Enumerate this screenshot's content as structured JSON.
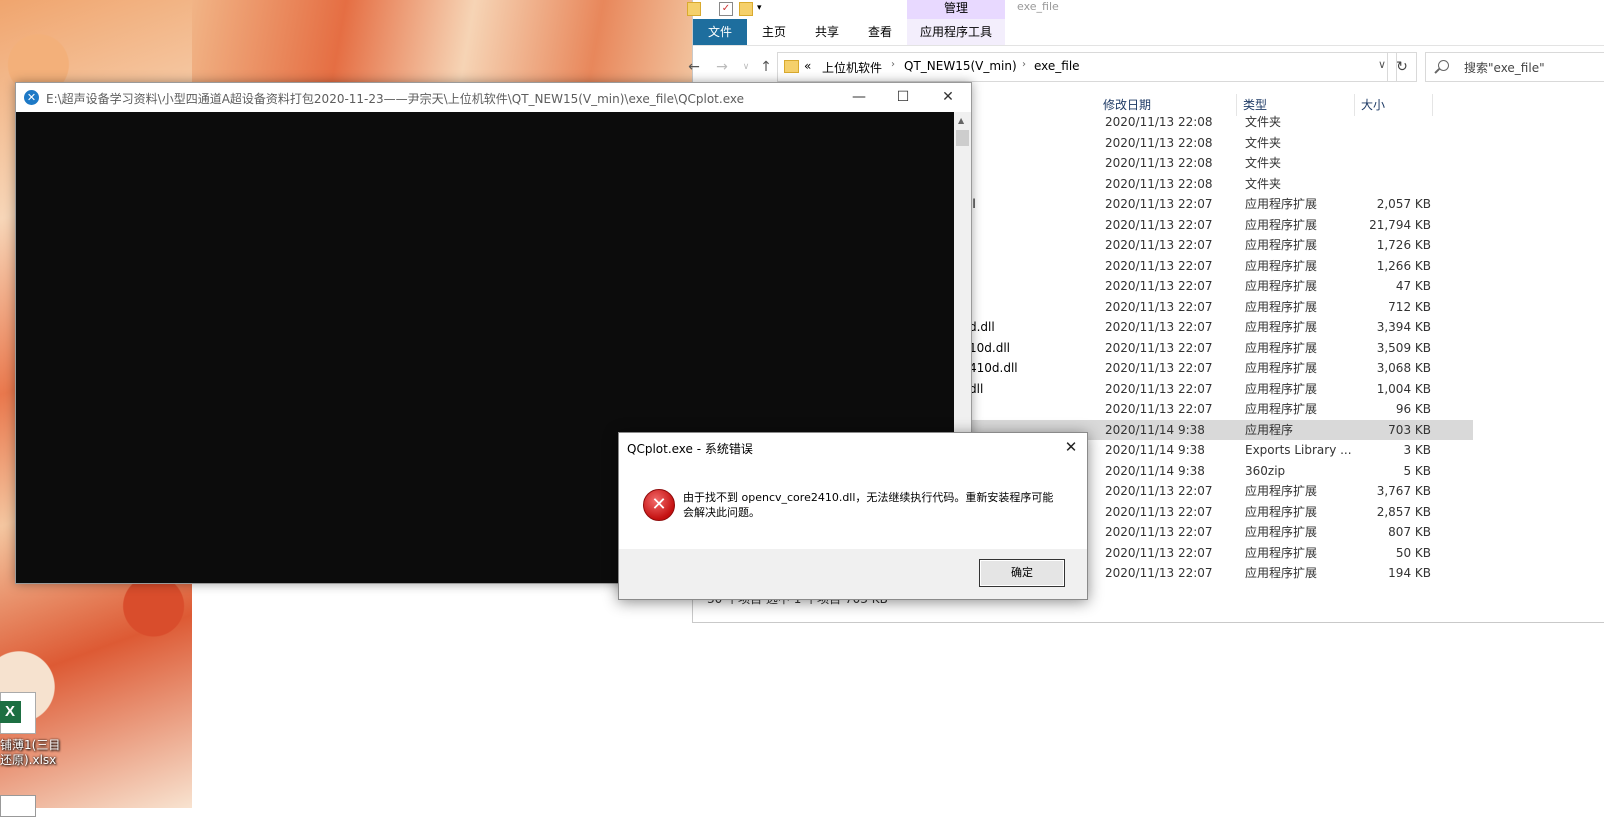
{
  "desktop": {
    "icon_label_1": "铺薄1(三目",
    "icon_label_2": "还原).xlsx"
  },
  "explorer": {
    "tab_manage": "管理",
    "title_mini": "exe_file",
    "ribbon_tabs": {
      "file": "文件",
      "home": "主页",
      "share": "共享",
      "view": "查看",
      "app_tools": "应用程序工具"
    },
    "breadcrumb": {
      "prefix": "«",
      "items": [
        "上位机软件",
        "QT_NEW15(V_min)",
        "exe_file"
      ]
    },
    "search_placeholder": "搜索\"exe_file\"",
    "columns": {
      "date": "修改日期",
      "type": "类型",
      "size": "大小"
    },
    "rows": [
      {
        "name": "",
        "date": "2020/11/13 22:08",
        "type": "文件夹",
        "size": ""
      },
      {
        "name": "",
        "date": "2020/11/13 22:08",
        "type": "文件夹",
        "size": ""
      },
      {
        "name": "",
        "date": "2020/11/13 22:08",
        "type": "文件夹",
        "size": ""
      },
      {
        "name": "",
        "date": "2020/11/13 22:08",
        "type": "文件夹",
        "size": ""
      },
      {
        "name": "ll",
        "date": "2020/11/13 22:07",
        "type": "应用程序扩展",
        "size": "2,057 KB"
      },
      {
        "name": "",
        "date": "2020/11/13 22:07",
        "type": "应用程序扩展",
        "size": "21,794 KB"
      },
      {
        "name": "",
        "date": "2020/11/13 22:07",
        "type": "应用程序扩展",
        "size": "1,726 KB"
      },
      {
        "name": "",
        "date": "2020/11/13 22:07",
        "type": "应用程序扩展",
        "size": "1,266 KB"
      },
      {
        "name": "",
        "date": "2020/11/13 22:07",
        "type": "应用程序扩展",
        "size": "47 KB"
      },
      {
        "name": "",
        "date": "2020/11/13 22:07",
        "type": "应用程序扩展",
        "size": "712 KB"
      },
      {
        "name": "d.dll",
        "date": "2020/11/13 22:07",
        "type": "应用程序扩展",
        "size": "3,394 KB"
      },
      {
        "name": "10d.dll",
        "date": "2020/11/13 22:07",
        "type": "应用程序扩展",
        "size": "3,509 KB"
      },
      {
        "name": "410d.dll",
        "date": "2020/11/13 22:07",
        "type": "应用程序扩展",
        "size": "3,068 KB"
      },
      {
        "name": "dll",
        "date": "2020/11/13 22:07",
        "type": "应用程序扩展",
        "size": "1,004 KB"
      },
      {
        "name": "",
        "date": "2020/11/13 22:07",
        "type": "应用程序扩展",
        "size": "96 KB"
      },
      {
        "name": "",
        "date": "2020/11/14 9:38",
        "type": "应用程序",
        "size": "703 KB"
      },
      {
        "name": "",
        "date": "2020/11/14 9:38",
        "type": "Exports Library ...",
        "size": "3 KB"
      },
      {
        "name": "",
        "date": "2020/11/14 9:38",
        "type": "360zip",
        "size": "5 KB"
      },
      {
        "name": "",
        "date": "2020/11/13 22:07",
        "type": "应用程序扩展",
        "size": "3,767 KB"
      },
      {
        "name": "",
        "date": "2020/11/13 22:07",
        "type": "应用程序扩展",
        "size": "2,857 KB"
      },
      {
        "name": "",
        "date": "2020/11/13 22:07",
        "type": "应用程序扩展",
        "size": "807 KB"
      },
      {
        "name": "",
        "date": "2020/11/13 22:07",
        "type": "应用程序扩展",
        "size": "50 KB"
      },
      {
        "name": "",
        "date": "2020/11/13 22:07",
        "type": "应用程序扩展",
        "size": "194 KB"
      }
    ],
    "selected_row_index": 15,
    "status_text": "30 个项目    选中 1 个项目  703 KB"
  },
  "console": {
    "title": "E:\\超声设备学习资料\\小型四通道A超设备资料打包2020-11-23——尹宗天\\上位机软件\\QT_NEW15(V_min)\\exe_file\\QCplot.exe",
    "body_bg": "#0c0c0c"
  },
  "dialog": {
    "title": "QCplot.exe - 系统错误",
    "message": "由于找不到 opencv_core2410.dll，无法继续执行代码。重新安装程序可能会解决此问题。",
    "ok_label": "确定"
  }
}
